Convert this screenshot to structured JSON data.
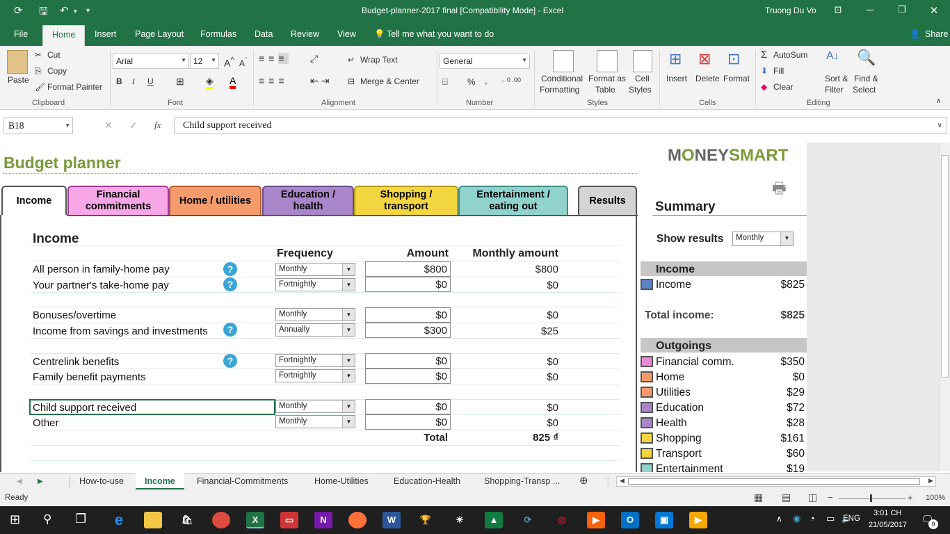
{
  "window": {
    "title": "Budget-planner-2017 final  [Compatibility Mode]  -  Excel",
    "user": "Truong Du Vo"
  },
  "menu": {
    "items": [
      "File",
      "Home",
      "Insert",
      "Page Layout",
      "Formulas",
      "Data",
      "Review",
      "View"
    ],
    "tell_me": "Tell me what you want to do",
    "share": "Share"
  },
  "ribbon": {
    "clipboard": {
      "paste": "Paste",
      "cut": "Cut",
      "copy": "Copy",
      "format_painter": "Format Painter",
      "label": "Clipboard"
    },
    "font": {
      "name": "Arial",
      "size": "12",
      "bold": "B",
      "italic": "I",
      "underline": "U",
      "label": "Font"
    },
    "alignment": {
      "wrap": "Wrap Text",
      "merge": "Merge & Center",
      "label": "Alignment"
    },
    "number": {
      "format": "General",
      "pct": "%",
      "comma": ",",
      "label": "Number"
    },
    "styles": {
      "cond1": "Conditional",
      "cond2": "Formatting",
      "fmt1": "Format as",
      "fmt2": "Table",
      "cell1": "Cell",
      "cell2": "Styles",
      "label": "Styles"
    },
    "cells": {
      "insert": "Insert",
      "delete": "Delete",
      "format": "Format",
      "label": "Cells"
    },
    "editing": {
      "autosum": "AutoSum",
      "fill": "Fill",
      "clear": "Clear",
      "sort1": "Sort &",
      "sort2": "Filter",
      "find1": "Find &",
      "find2": "Select",
      "label": "Editing"
    }
  },
  "formula_bar": {
    "name_box": "B18",
    "content": "Child support received"
  },
  "sheet": {
    "title": "Budget planner",
    "logo_left": "M",
    "logo_o": "O",
    "logo_mid": "NEY",
    "logo_right": "SMART",
    "tabs": [
      {
        "l1": "Income",
        "l2": ""
      },
      {
        "l1": "Financial",
        "l2": "commitments"
      },
      {
        "l1": "Home / utilities",
        "l2": ""
      },
      {
        "l1": "Education /",
        "l2": "health"
      },
      {
        "l1": "Shopping /",
        "l2": "transport"
      },
      {
        "l1": "Entertainment /",
        "l2": "eating out"
      },
      {
        "l1": "Results",
        "l2": ""
      }
    ],
    "section": "Income",
    "headers": {
      "frequency": "Frequency",
      "amount": "Amount",
      "monthly": "Monthly amount"
    },
    "rows": [
      {
        "label": "All person in family-home pay",
        "freq": "Monthly",
        "amount": "$800",
        "monthly": "$800"
      },
      {
        "label": "Your partner's take-home pay",
        "freq": "Fortnightly",
        "amount": "$0",
        "monthly": "$0"
      },
      {
        "label": "Bonuses/overtime",
        "freq": "Monthly",
        "amount": "$0",
        "monthly": "$0"
      },
      {
        "label": "Income from savings and investments",
        "freq": "Annually",
        "amount": "$300",
        "monthly": "$25"
      },
      {
        "label": "Centrelink benefits",
        "freq": "Fortnightly",
        "amount": "$0",
        "monthly": "$0"
      },
      {
        "label": "Family benefit payments",
        "freq": "Fortnightly",
        "amount": "$0",
        "monthly": "$0"
      },
      {
        "label": "Child support received",
        "freq": "Monthly",
        "amount": "$0",
        "monthly": "$0"
      },
      {
        "label": "Other",
        "freq": "Monthly",
        "amount": "$0",
        "monthly": "$0"
      }
    ],
    "total_label": "Total",
    "total_value": "825 ₫",
    "summary": {
      "title": "Summary",
      "show_results": "Show results",
      "period": "Monthly",
      "income_header": "Income",
      "income_label": "Income",
      "income_value": "$825",
      "total_income_label": "Total income:",
      "total_income_value": "$825",
      "outgoings_header": "Outgoings",
      "items": [
        {
          "label": "Financial comm.",
          "value": "$350",
          "color": "#e78bd9"
        },
        {
          "label": "Home",
          "value": "$0",
          "color": "#f39b6b"
        },
        {
          "label": "Utilities",
          "value": "$29",
          "color": "#f39b6b"
        },
        {
          "label": "Education",
          "value": "$72",
          "color": "#a985c9"
        },
        {
          "label": "Health",
          "value": "$28",
          "color": "#a985c9"
        },
        {
          "label": "Shopping",
          "value": "$161",
          "color": "#f3d640"
        },
        {
          "label": "Transport",
          "value": "$60",
          "color": "#f3d640"
        },
        {
          "label": "Entertainment",
          "value": "$19",
          "color": "#8fd3cc"
        }
      ]
    }
  },
  "sheet_tabs": [
    "How-to-use",
    "Income",
    "Financial-Commitments",
    "Home-Utilities",
    "Education-Health",
    "Shopping-Transp ..."
  ],
  "status": {
    "ready": "Ready",
    "zoom": "100%"
  },
  "taskbar": {
    "lang": "ENG",
    "time": "3:01 CH",
    "date": "21/05/2017",
    "badge": "9"
  }
}
